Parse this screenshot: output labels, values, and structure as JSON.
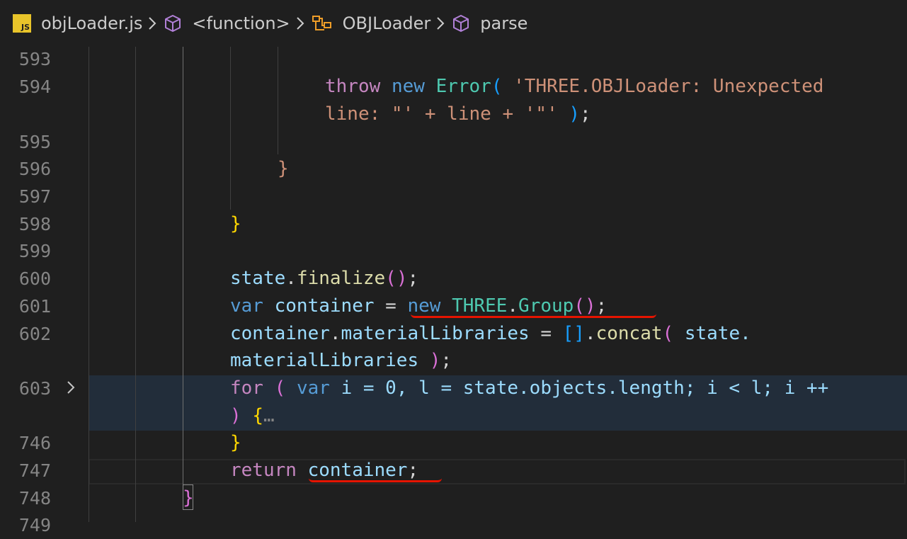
{
  "breadcrumb": {
    "file_badge": "JS",
    "items": [
      "objLoader.js",
      "<function>",
      "OBJLoader",
      "parse"
    ],
    "separator": ">"
  },
  "editor": {
    "fold_ellipsis": "…",
    "lines": [
      {
        "number": "593"
      },
      {
        "number": "594",
        "text_a": "throw",
        "text_b": "new",
        "text_c": "Error",
        "text_d": "(",
        "text_e": "'THREE.OBJLoader: Unexpected",
        "wrap": "line: \"' + line + '\"'",
        "wrap_close": ")",
        "wrap_semi": ";"
      },
      {
        "number": "595"
      },
      {
        "number": "596",
        "text": "}"
      },
      {
        "number": "597"
      },
      {
        "number": "598",
        "text": "}"
      },
      {
        "number": "599"
      },
      {
        "number": "600",
        "obj": "state",
        "dot": ".",
        "method": "finalize",
        "parens": "()",
        "semi": ";"
      },
      {
        "number": "601",
        "kw": "var",
        "name": "container",
        "eq": "=",
        "new": "new",
        "cls": "THREE",
        "dot": ".",
        "method": "Group",
        "parens": "()",
        "semi": ";"
      },
      {
        "number": "602",
        "obj": "container",
        "dot": ".",
        "prop": "materialLibraries",
        "eq": "=",
        "arr": "[]",
        "dot2": ".",
        "method": "concat",
        "open": "(",
        "arg": "state.",
        "wrap": "materialLibraries",
        "close": ")",
        "semi": ";"
      },
      {
        "number": "603",
        "kw": "for",
        "open": "(",
        "var": "var",
        "rest": "i = 0, l = state.objects.length; i < l; i ++",
        "close": ")",
        "brace": "{"
      },
      {
        "number": "746",
        "text": "}"
      },
      {
        "number": "747",
        "kw": "return",
        "name": "container",
        "semi": ";"
      },
      {
        "number": "748",
        "text": "}"
      },
      {
        "number": "749"
      }
    ]
  },
  "colors": {
    "background": "#1f1f1f",
    "keyword": "#c586c0",
    "storage": "#569cd6",
    "class": "#4ec9b0",
    "function": "#dcdcaa",
    "string": "#ce9178",
    "number": "#b5cea8",
    "variable": "#9cdcfe",
    "error_squiggle": "#e51400"
  }
}
